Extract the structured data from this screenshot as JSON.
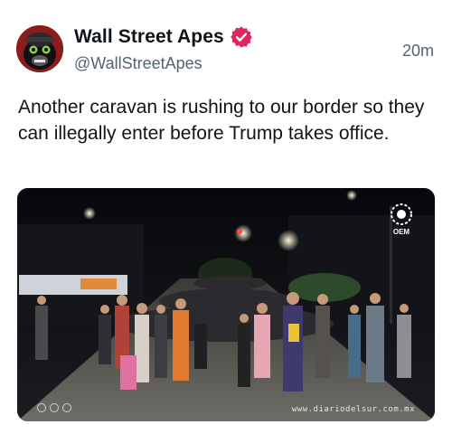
{
  "author": {
    "display_name": "Wall Street Apes",
    "handle": "@WallStreetApes",
    "verified_icon": "verified-badge-icon",
    "verified_color": "#e0245e",
    "avatar_icon": "gorilla-avatar-icon"
  },
  "timestamp": "20m",
  "post": {
    "text": "Another caravan is rushing to our border so they can illegally enter before Trump takes office."
  },
  "media": {
    "logo_text": "OEM",
    "watermark": "www.diariodelsur.com.mx"
  }
}
